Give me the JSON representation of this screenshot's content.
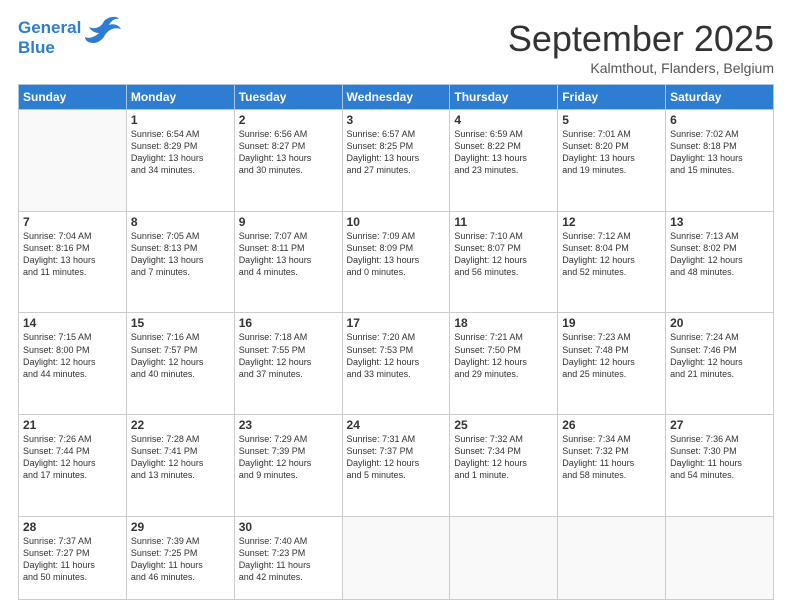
{
  "logo": {
    "line1": "General",
    "line2": "Blue"
  },
  "title": "September 2025",
  "location": "Kalmthout, Flanders, Belgium",
  "days_header": [
    "Sunday",
    "Monday",
    "Tuesday",
    "Wednesday",
    "Thursday",
    "Friday",
    "Saturday"
  ],
  "weeks": [
    [
      {
        "day": "",
        "info": ""
      },
      {
        "day": "1",
        "info": "Sunrise: 6:54 AM\nSunset: 8:29 PM\nDaylight: 13 hours\nand 34 minutes."
      },
      {
        "day": "2",
        "info": "Sunrise: 6:56 AM\nSunset: 8:27 PM\nDaylight: 13 hours\nand 30 minutes."
      },
      {
        "day": "3",
        "info": "Sunrise: 6:57 AM\nSunset: 8:25 PM\nDaylight: 13 hours\nand 27 minutes."
      },
      {
        "day": "4",
        "info": "Sunrise: 6:59 AM\nSunset: 8:22 PM\nDaylight: 13 hours\nand 23 minutes."
      },
      {
        "day": "5",
        "info": "Sunrise: 7:01 AM\nSunset: 8:20 PM\nDaylight: 13 hours\nand 19 minutes."
      },
      {
        "day": "6",
        "info": "Sunrise: 7:02 AM\nSunset: 8:18 PM\nDaylight: 13 hours\nand 15 minutes."
      }
    ],
    [
      {
        "day": "7",
        "info": "Sunrise: 7:04 AM\nSunset: 8:16 PM\nDaylight: 13 hours\nand 11 minutes."
      },
      {
        "day": "8",
        "info": "Sunrise: 7:05 AM\nSunset: 8:13 PM\nDaylight: 13 hours\nand 7 minutes."
      },
      {
        "day": "9",
        "info": "Sunrise: 7:07 AM\nSunset: 8:11 PM\nDaylight: 13 hours\nand 4 minutes."
      },
      {
        "day": "10",
        "info": "Sunrise: 7:09 AM\nSunset: 8:09 PM\nDaylight: 13 hours\nand 0 minutes."
      },
      {
        "day": "11",
        "info": "Sunrise: 7:10 AM\nSunset: 8:07 PM\nDaylight: 12 hours\nand 56 minutes."
      },
      {
        "day": "12",
        "info": "Sunrise: 7:12 AM\nSunset: 8:04 PM\nDaylight: 12 hours\nand 52 minutes."
      },
      {
        "day": "13",
        "info": "Sunrise: 7:13 AM\nSunset: 8:02 PM\nDaylight: 12 hours\nand 48 minutes."
      }
    ],
    [
      {
        "day": "14",
        "info": "Sunrise: 7:15 AM\nSunset: 8:00 PM\nDaylight: 12 hours\nand 44 minutes."
      },
      {
        "day": "15",
        "info": "Sunrise: 7:16 AM\nSunset: 7:57 PM\nDaylight: 12 hours\nand 40 minutes."
      },
      {
        "day": "16",
        "info": "Sunrise: 7:18 AM\nSunset: 7:55 PM\nDaylight: 12 hours\nand 37 minutes."
      },
      {
        "day": "17",
        "info": "Sunrise: 7:20 AM\nSunset: 7:53 PM\nDaylight: 12 hours\nand 33 minutes."
      },
      {
        "day": "18",
        "info": "Sunrise: 7:21 AM\nSunset: 7:50 PM\nDaylight: 12 hours\nand 29 minutes."
      },
      {
        "day": "19",
        "info": "Sunrise: 7:23 AM\nSunset: 7:48 PM\nDaylight: 12 hours\nand 25 minutes."
      },
      {
        "day": "20",
        "info": "Sunrise: 7:24 AM\nSunset: 7:46 PM\nDaylight: 12 hours\nand 21 minutes."
      }
    ],
    [
      {
        "day": "21",
        "info": "Sunrise: 7:26 AM\nSunset: 7:44 PM\nDaylight: 12 hours\nand 17 minutes."
      },
      {
        "day": "22",
        "info": "Sunrise: 7:28 AM\nSunset: 7:41 PM\nDaylight: 12 hours\nand 13 minutes."
      },
      {
        "day": "23",
        "info": "Sunrise: 7:29 AM\nSunset: 7:39 PM\nDaylight: 12 hours\nand 9 minutes."
      },
      {
        "day": "24",
        "info": "Sunrise: 7:31 AM\nSunset: 7:37 PM\nDaylight: 12 hours\nand 5 minutes."
      },
      {
        "day": "25",
        "info": "Sunrise: 7:32 AM\nSunset: 7:34 PM\nDaylight: 12 hours\nand 1 minute."
      },
      {
        "day": "26",
        "info": "Sunrise: 7:34 AM\nSunset: 7:32 PM\nDaylight: 11 hours\nand 58 minutes."
      },
      {
        "day": "27",
        "info": "Sunrise: 7:36 AM\nSunset: 7:30 PM\nDaylight: 11 hours\nand 54 minutes."
      }
    ],
    [
      {
        "day": "28",
        "info": "Sunrise: 7:37 AM\nSunset: 7:27 PM\nDaylight: 11 hours\nand 50 minutes."
      },
      {
        "day": "29",
        "info": "Sunrise: 7:39 AM\nSunset: 7:25 PM\nDaylight: 11 hours\nand 46 minutes."
      },
      {
        "day": "30",
        "info": "Sunrise: 7:40 AM\nSunset: 7:23 PM\nDaylight: 11 hours\nand 42 minutes."
      },
      {
        "day": "",
        "info": ""
      },
      {
        "day": "",
        "info": ""
      },
      {
        "day": "",
        "info": ""
      },
      {
        "day": "",
        "info": ""
      }
    ]
  ]
}
